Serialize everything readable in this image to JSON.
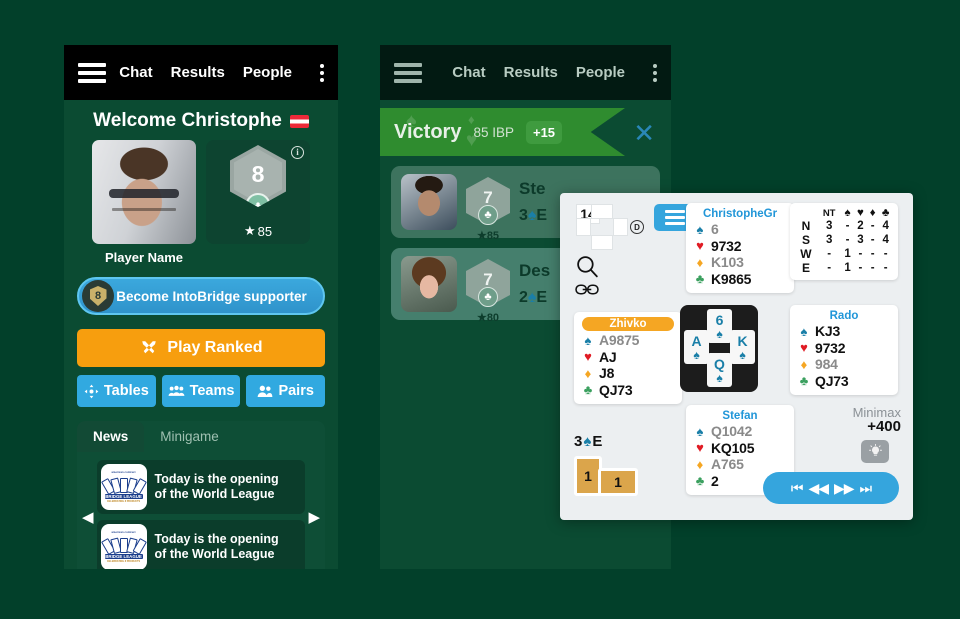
{
  "nav": {
    "menu_icon": "hamburger-icon",
    "links": [
      "Chat",
      "Results",
      "People"
    ],
    "more_icon": "kebab-menu-icon"
  },
  "home": {
    "welcome": "Welcome Christophe",
    "flag": "at",
    "player_name": "Player Name",
    "rank": {
      "level": "8",
      "suit": "♣",
      "stars": "85",
      "info": "i"
    },
    "supporter_button": "Become IntoBridge supporter",
    "supporter_badge": "8",
    "play_ranked": "Play Ranked",
    "quick_buttons": [
      {
        "label": "Tables",
        "icon": "tables-icon"
      },
      {
        "label": "Teams",
        "icon": "teams-icon"
      },
      {
        "label": "Pairs",
        "icon": "pairs-icon"
      }
    ],
    "news": {
      "tabs": [
        "News",
        "Minigame"
      ],
      "active_tab": "News",
      "items": [
        {
          "line1": "Today is the opening",
          "line2": "of the World League",
          "logo_top": "american contract",
          "logo_bar": "BRIDGE LEAGUE",
          "logo_sub": "CELEBRATING 8 PRODUCTS"
        },
        {
          "line1": "Today is the opening",
          "line2": "of the World League",
          "logo_top": "american contract",
          "logo_bar": "BRIDGE LEAGUE",
          "logo_sub": "CELEBRATING 8 PRODUCTS"
        }
      ],
      "dot_count": 5,
      "active_dot": 0,
      "prev_arrow": "◀",
      "next_arrow": "▶"
    }
  },
  "results": {
    "banner": {
      "title": "Victory",
      "ibp": "85 IBP",
      "points": "+15",
      "close": "✕"
    },
    "rows": [
      {
        "name": "Ste",
        "contract": "3",
        "contract_suit": "♠",
        "contract_dir": "E",
        "level": "7",
        "suit": "♣",
        "stars": "85",
        "avatar": "m"
      },
      {
        "name": "Des",
        "contract": "2",
        "contract_suit": "♠",
        "contract_dir": "E",
        "level": "7",
        "suit": "♣",
        "stars": "80",
        "avatar": "f"
      }
    ]
  },
  "bridge": {
    "board_number": "14",
    "dealer": "D",
    "menu_icon": "hamburger-icon",
    "search_icon": "search-icon",
    "link_icon": "link-icon",
    "hands": {
      "north": {
        "name": "ChristopheGr",
        "highlight": false,
        "suits": [
          {
            "symbol": "♠",
            "suit": "spade",
            "cards": "6",
            "muted": true
          },
          {
            "symbol": "♥",
            "suit": "heart",
            "cards": "9732",
            "muted": false
          },
          {
            "symbol": "♦",
            "suit": "diamond",
            "cards": "K103",
            "muted": true
          },
          {
            "symbol": "♣",
            "suit": "club",
            "cards": "K9865",
            "muted": false
          }
        ]
      },
      "west": {
        "name": "Zhivko",
        "highlight": true,
        "suits": [
          {
            "symbol": "♠",
            "suit": "spade",
            "cards": "A9875",
            "muted": true
          },
          {
            "symbol": "♥",
            "suit": "heart",
            "cards": "AJ",
            "muted": false
          },
          {
            "symbol": "♦",
            "suit": "diamond",
            "cards": "J8",
            "muted": false
          },
          {
            "symbol": "♣",
            "suit": "club",
            "cards": "QJ73",
            "muted": false
          }
        ]
      },
      "east": {
        "name": "Rado",
        "highlight": false,
        "suits": [
          {
            "symbol": "♠",
            "suit": "spade",
            "cards": "KJ3",
            "muted": false
          },
          {
            "symbol": "♥",
            "suit": "heart",
            "cards": "9732",
            "muted": false
          },
          {
            "symbol": "♦",
            "suit": "diamond",
            "cards": "984",
            "muted": true
          },
          {
            "symbol": "♣",
            "suit": "club",
            "cards": "QJ73",
            "muted": false
          }
        ]
      },
      "south": {
        "name": "Stefan",
        "highlight": false,
        "suits": [
          {
            "symbol": "♠",
            "suit": "spade",
            "cards": "Q1042",
            "muted": true
          },
          {
            "symbol": "♥",
            "suit": "heart",
            "cards": "KQ105",
            "muted": false
          },
          {
            "symbol": "♦",
            "suit": "diamond",
            "cards": "A765",
            "muted": true
          },
          {
            "symbol": "♣",
            "suit": "club",
            "cards": "2",
            "muted": false
          }
        ]
      }
    },
    "trick": {
      "north": {
        "rank": "6",
        "suit": "♠"
      },
      "west": {
        "rank": "A",
        "suit": "♠"
      },
      "east": {
        "rank": "K",
        "suit": "♠"
      },
      "south": {
        "rank": "Q",
        "suit": "♠"
      }
    },
    "contract": {
      "level": "3",
      "suit": "♠",
      "declarer": "E"
    },
    "tricks_won": [
      "1",
      "1"
    ],
    "minimax": {
      "header_label": "Minimax",
      "score": "+400",
      "table": {
        "columns": [
          "NT",
          "♠",
          "♥",
          "♦",
          "♣"
        ],
        "rows": [
          {
            "dir": "N",
            "values": [
              "3",
              "-",
              "2",
              "-",
              "4"
            ]
          },
          {
            "dir": "S",
            "values": [
              "3",
              "-",
              "3",
              "-",
              "4"
            ]
          },
          {
            "dir": "W",
            "values": [
              "-",
              "1",
              "-",
              "-",
              "-"
            ]
          },
          {
            "dir": "E",
            "values": [
              "-",
              "1",
              "-",
              "-",
              "-"
            ]
          }
        ]
      }
    },
    "hint_icon": "lightbulb-icon",
    "playback": [
      "⏮",
      "◀◀",
      "▶▶",
      "⏭"
    ]
  },
  "colors": {
    "background": "#02402a",
    "spade": "#1a7fa8",
    "heart": "#e01b24",
    "diamond": "#f5a623",
    "club": "#3ba05f",
    "accent_blue": "#35a5dd",
    "accent_orange": "#f79e0e",
    "victory_green": "#2f8c2f"
  }
}
